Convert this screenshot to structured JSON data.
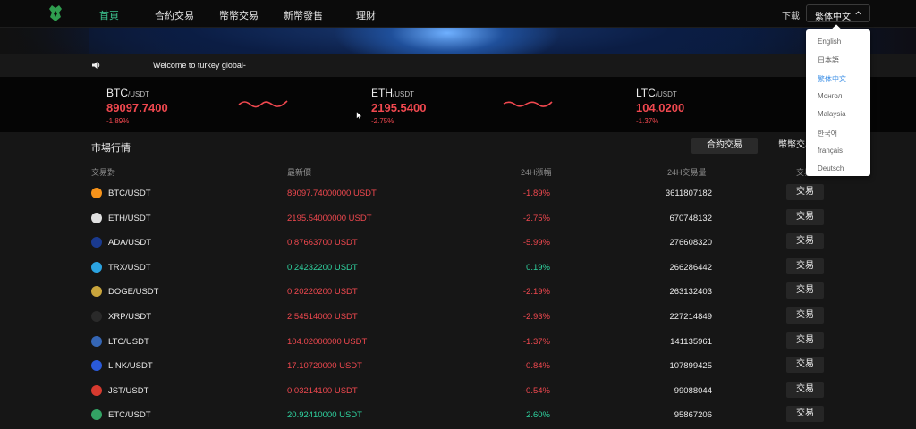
{
  "header": {
    "nav": [
      "首頁",
      "合約交易",
      "幣幣交易",
      "新幣發售",
      "理財"
    ],
    "download": "下載",
    "language": "繁体中文"
  },
  "notice": {
    "text": "Welcome to turkey global-"
  },
  "tickers": [
    {
      "base": "BTC",
      "quote": "/USDT",
      "price": "89097.7400",
      "change": "-1.89%"
    },
    {
      "base": "ETH",
      "quote": "/USDT",
      "price": "2195.5400",
      "change": "-2.75%"
    },
    {
      "base": "LTC",
      "quote": "/USDT",
      "price": "104.0200",
      "change": "-1.37%"
    }
  ],
  "market": {
    "title": "市場行情",
    "tabs": [
      "合約交易",
      "幣幣交易"
    ],
    "headers": [
      "交易對",
      "最新價",
      "24H漲幅",
      "24H交易量",
      "交易"
    ],
    "trade_label": "交易",
    "rows": [
      {
        "pair": "BTC/USDT",
        "price": "89097.74000000 USDT",
        "change": "-1.89%",
        "volume": "3611807182",
        "dir": "down",
        "icon": "btc-icon",
        "color": "#f7931a"
      },
      {
        "pair": "ETH/USDT",
        "price": "2195.54000000 USDT",
        "change": "-2.75%",
        "volume": "670748132",
        "dir": "down",
        "icon": "eth-icon",
        "color": "#e0e0e0"
      },
      {
        "pair": "ADA/USDT",
        "price": "0.87663700 USDT",
        "change": "-5.99%",
        "volume": "276608320",
        "dir": "down",
        "icon": "ada-icon",
        "color": "#1a3a8f"
      },
      {
        "pair": "TRX/USDT",
        "price": "0.24232200 USDT",
        "change": "0.19%",
        "volume": "266286442",
        "dir": "up",
        "icon": "trx-icon",
        "color": "#2ba3e0"
      },
      {
        "pair": "DOGE/USDT",
        "price": "0.20220200 USDT",
        "change": "-2.19%",
        "volume": "263132403",
        "dir": "down",
        "icon": "doge-icon",
        "color": "#c9a53c"
      },
      {
        "pair": "XRP/USDT",
        "price": "2.54514000 USDT",
        "change": "-2.93%",
        "volume": "227214849",
        "dir": "down",
        "icon": "xrp-icon",
        "color": "#2a2a2a"
      },
      {
        "pair": "LTC/USDT",
        "price": "104.02000000 USDT",
        "change": "-1.37%",
        "volume": "141135961",
        "dir": "down",
        "icon": "ltc-icon",
        "color": "#3566b5"
      },
      {
        "pair": "LINK/USDT",
        "price": "17.10720000 USDT",
        "change": "-0.84%",
        "volume": "107899425",
        "dir": "down",
        "icon": "link-icon",
        "color": "#2a5ada"
      },
      {
        "pair": "JST/USDT",
        "price": "0.03214100 USDT",
        "change": "-0.54%",
        "volume": "99088044",
        "dir": "down",
        "icon": "jst-icon",
        "color": "#d63a2f"
      },
      {
        "pair": "ETC/USDT",
        "price": "20.92410000 USDT",
        "change": "2.60%",
        "volume": "95867206",
        "dir": "up",
        "icon": "etc-icon",
        "color": "#33a364"
      }
    ]
  },
  "languages": [
    "English",
    "日本語",
    "繁体中文",
    "Монгол",
    "Malaysia",
    "한국어",
    "français",
    "Deutsch"
  ],
  "colors": {
    "accent": "#3cc48f",
    "down": "#f0484f",
    "up": "#2fd3a0",
    "link": "#3a8ee6"
  }
}
